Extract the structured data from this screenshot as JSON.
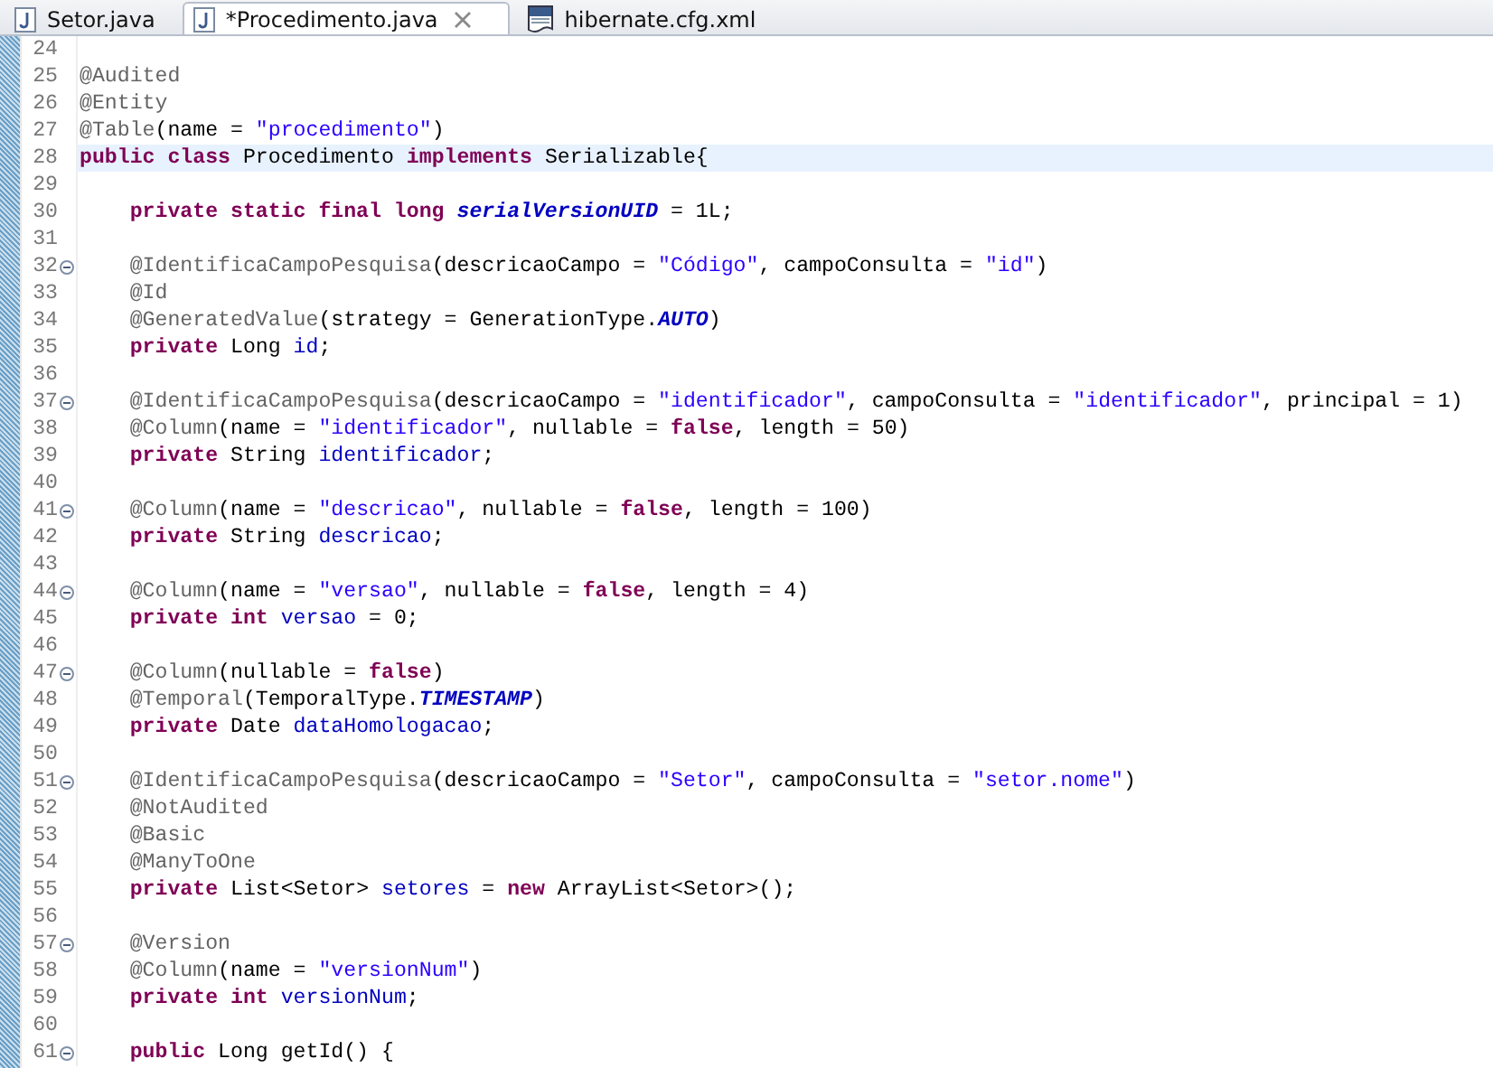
{
  "tabs": [
    {
      "label": "Setor.java",
      "kind": "java",
      "selected": false,
      "closable": false
    },
    {
      "label": "*Procedimento.java",
      "kind": "java",
      "selected": true,
      "closable": true
    },
    {
      "label": "hibernate.cfg.xml",
      "kind": "xml",
      "selected": false,
      "closable": false
    }
  ],
  "editor": {
    "lines": [
      {
        "number": "24",
        "foldable": false,
        "current": false
      },
      {
        "number": "25",
        "foldable": false,
        "indented": false,
        "current": false,
        "code": [
          {
            "kind": "annotation",
            "text": "@Audited"
          }
        ]
      },
      {
        "number": "26",
        "foldable": false,
        "indented": false,
        "current": false,
        "code": [
          {
            "kind": "annotation",
            "text": "@Entity"
          }
        ]
      },
      {
        "number": "27",
        "foldable": false,
        "indented": false,
        "current": false,
        "code": [
          {
            "kind": "annotation",
            "text": "@Table"
          },
          {
            "kind": "plain",
            "text": "(name = "
          },
          {
            "kind": "string",
            "text": "\"procedimento\""
          },
          {
            "kind": "plain",
            "text": ")"
          }
        ]
      },
      {
        "number": "28",
        "foldable": false,
        "indented": false,
        "current": true,
        "code": [
          {
            "kind": "keyword",
            "text": "public class "
          },
          {
            "kind": "plain",
            "text": "Procedimento "
          },
          {
            "kind": "keyword",
            "text": "implements "
          },
          {
            "kind": "plain",
            "text": "Serializable{"
          }
        ]
      },
      {
        "number": "29",
        "foldable": false,
        "current": false
      },
      {
        "number": "30",
        "foldable": false,
        "indented": true,
        "current": false,
        "code": [
          {
            "kind": "keyword",
            "text": "private static final long "
          },
          {
            "kind": "static",
            "text": "serialVersionUID"
          },
          {
            "kind": "plain",
            "text": " = 1L;"
          }
        ]
      },
      {
        "number": "31",
        "foldable": false,
        "current": false
      },
      {
        "number": "32",
        "foldable": true,
        "indented": true,
        "current": false,
        "code": [
          {
            "kind": "annotation",
            "text": "@IdentificaCampoPesquisa"
          },
          {
            "kind": "plain",
            "text": "(descricaoCampo = "
          },
          {
            "kind": "string",
            "text": "\"Código\""
          },
          {
            "kind": "plain",
            "text": ", campoConsulta = "
          },
          {
            "kind": "string",
            "text": "\"id\""
          },
          {
            "kind": "plain",
            "text": ")"
          }
        ]
      },
      {
        "number": "33",
        "foldable": false,
        "indented": true,
        "current": false,
        "code": [
          {
            "kind": "annotation",
            "text": "@Id"
          }
        ]
      },
      {
        "number": "34",
        "foldable": false,
        "indented": true,
        "current": false,
        "code": [
          {
            "kind": "annotation",
            "text": "@GeneratedValue"
          },
          {
            "kind": "plain",
            "text": "(strategy = GenerationType."
          },
          {
            "kind": "static",
            "text": "AUTO"
          },
          {
            "kind": "plain",
            "text": ")"
          }
        ]
      },
      {
        "number": "35",
        "foldable": false,
        "indented": true,
        "current": false,
        "code": [
          {
            "kind": "keyword",
            "text": "private "
          },
          {
            "kind": "plain",
            "text": "Long "
          },
          {
            "kind": "field",
            "text": "id"
          },
          {
            "kind": "plain",
            "text": ";"
          }
        ]
      },
      {
        "number": "36",
        "foldable": false,
        "current": false
      },
      {
        "number": "37",
        "foldable": true,
        "indented": true,
        "current": false,
        "code": [
          {
            "kind": "annotation",
            "text": "@IdentificaCampoPesquisa"
          },
          {
            "kind": "plain",
            "text": "(descricaoCampo = "
          },
          {
            "kind": "string",
            "text": "\"identificador\""
          },
          {
            "kind": "plain",
            "text": ", campoConsulta = "
          },
          {
            "kind": "string",
            "text": "\"identificador\""
          },
          {
            "kind": "plain",
            "text": ", principal = 1)"
          }
        ]
      },
      {
        "number": "38",
        "foldable": false,
        "indented": true,
        "current": false,
        "code": [
          {
            "kind": "annotation",
            "text": "@Column"
          },
          {
            "kind": "plain",
            "text": "(name = "
          },
          {
            "kind": "string",
            "text": "\"identificador\""
          },
          {
            "kind": "plain",
            "text": ", nullable = "
          },
          {
            "kind": "keyword",
            "text": "false"
          },
          {
            "kind": "plain",
            "text": ", length = 50)"
          }
        ]
      },
      {
        "number": "39",
        "foldable": false,
        "indented": true,
        "current": false,
        "code": [
          {
            "kind": "keyword",
            "text": "private "
          },
          {
            "kind": "plain",
            "text": "String "
          },
          {
            "kind": "field",
            "text": "identificador"
          },
          {
            "kind": "plain",
            "text": ";"
          }
        ]
      },
      {
        "number": "40",
        "foldable": false,
        "current": false
      },
      {
        "number": "41",
        "foldable": true,
        "indented": true,
        "current": false,
        "code": [
          {
            "kind": "annotation",
            "text": "@Column"
          },
          {
            "kind": "plain",
            "text": "(name = "
          },
          {
            "kind": "string",
            "text": "\"descricao\""
          },
          {
            "kind": "plain",
            "text": ", nullable = "
          },
          {
            "kind": "keyword",
            "text": "false"
          },
          {
            "kind": "plain",
            "text": ", length = 100)"
          }
        ]
      },
      {
        "number": "42",
        "foldable": false,
        "indented": true,
        "current": false,
        "code": [
          {
            "kind": "keyword",
            "text": "private "
          },
          {
            "kind": "plain",
            "text": "String "
          },
          {
            "kind": "field",
            "text": "descricao"
          },
          {
            "kind": "plain",
            "text": ";"
          }
        ]
      },
      {
        "number": "43",
        "foldable": false,
        "current": false
      },
      {
        "number": "44",
        "foldable": true,
        "indented": true,
        "current": false,
        "code": [
          {
            "kind": "annotation",
            "text": "@Column"
          },
          {
            "kind": "plain",
            "text": "(name = "
          },
          {
            "kind": "string",
            "text": "\"versao\""
          },
          {
            "kind": "plain",
            "text": ", nullable = "
          },
          {
            "kind": "keyword",
            "text": "false"
          },
          {
            "kind": "plain",
            "text": ", length = 4)"
          }
        ]
      },
      {
        "number": "45",
        "foldable": false,
        "indented": true,
        "current": false,
        "code": [
          {
            "kind": "keyword",
            "text": "private int "
          },
          {
            "kind": "field",
            "text": "versao"
          },
          {
            "kind": "plain",
            "text": " = 0;"
          }
        ]
      },
      {
        "number": "46",
        "foldable": false,
        "current": false
      },
      {
        "number": "47",
        "foldable": true,
        "indented": true,
        "current": false,
        "code": [
          {
            "kind": "annotation",
            "text": "@Column"
          },
          {
            "kind": "plain",
            "text": "(nullable = "
          },
          {
            "kind": "keyword",
            "text": "false"
          },
          {
            "kind": "plain",
            "text": ")"
          }
        ]
      },
      {
        "number": "48",
        "foldable": false,
        "indented": true,
        "current": false,
        "code": [
          {
            "kind": "annotation",
            "text": "@Temporal"
          },
          {
            "kind": "plain",
            "text": "(TemporalType."
          },
          {
            "kind": "static",
            "text": "TIMESTAMP"
          },
          {
            "kind": "plain",
            "text": ")"
          }
        ]
      },
      {
        "number": "49",
        "foldable": false,
        "indented": true,
        "current": false,
        "code": [
          {
            "kind": "keyword",
            "text": "private "
          },
          {
            "kind": "plain",
            "text": "Date "
          },
          {
            "kind": "field",
            "text": "dataHomologacao"
          },
          {
            "kind": "plain",
            "text": ";"
          }
        ]
      },
      {
        "number": "50",
        "foldable": false,
        "current": false
      },
      {
        "number": "51",
        "foldable": true,
        "indented": true,
        "current": false,
        "code": [
          {
            "kind": "annotation",
            "text": "@IdentificaCampoPesquisa"
          },
          {
            "kind": "plain",
            "text": "(descricaoCampo = "
          },
          {
            "kind": "string",
            "text": "\"Setor\""
          },
          {
            "kind": "plain",
            "text": ", campoConsulta = "
          },
          {
            "kind": "string",
            "text": "\"setor.nome\""
          },
          {
            "kind": "plain",
            "text": ")"
          }
        ]
      },
      {
        "number": "52",
        "foldable": false,
        "indented": true,
        "current": false,
        "code": [
          {
            "kind": "annotation",
            "text": "@NotAudited"
          }
        ]
      },
      {
        "number": "53",
        "foldable": false,
        "indented": true,
        "current": false,
        "code": [
          {
            "kind": "annotation",
            "text": "@Basic"
          }
        ]
      },
      {
        "number": "54",
        "foldable": false,
        "indented": true,
        "current": false,
        "code": [
          {
            "kind": "annotation",
            "text": "@ManyToOne"
          }
        ]
      },
      {
        "number": "55",
        "foldable": false,
        "indented": true,
        "current": false,
        "code": [
          {
            "kind": "keyword",
            "text": "private "
          },
          {
            "kind": "plain",
            "text": "List<Setor> "
          },
          {
            "kind": "field",
            "text": "setores"
          },
          {
            "kind": "plain",
            "text": " = "
          },
          {
            "kind": "keyword",
            "text": "new "
          },
          {
            "kind": "plain",
            "text": "ArrayList<Setor>();"
          }
        ]
      },
      {
        "number": "56",
        "foldable": false,
        "current": false
      },
      {
        "number": "57",
        "foldable": true,
        "indented": true,
        "current": false,
        "code": [
          {
            "kind": "annotation",
            "text": "@Version"
          }
        ]
      },
      {
        "number": "58",
        "foldable": false,
        "indented": true,
        "current": false,
        "code": [
          {
            "kind": "annotation",
            "text": "@Column"
          },
          {
            "kind": "plain",
            "text": "(name = "
          },
          {
            "kind": "string",
            "text": "\"versionNum\""
          },
          {
            "kind": "plain",
            "text": ")"
          }
        ]
      },
      {
        "number": "59",
        "foldable": false,
        "indented": true,
        "current": false,
        "code": [
          {
            "kind": "keyword",
            "text": "private int "
          },
          {
            "kind": "field",
            "text": "versionNum"
          },
          {
            "kind": "plain",
            "text": ";"
          }
        ]
      },
      {
        "number": "60",
        "foldable": false,
        "current": false
      },
      {
        "number": "61",
        "foldable": true,
        "indented": true,
        "current": false,
        "code": [
          {
            "kind": "keyword",
            "text": "public "
          },
          {
            "kind": "plain",
            "text": "Long getId() {"
          }
        ]
      }
    ]
  }
}
